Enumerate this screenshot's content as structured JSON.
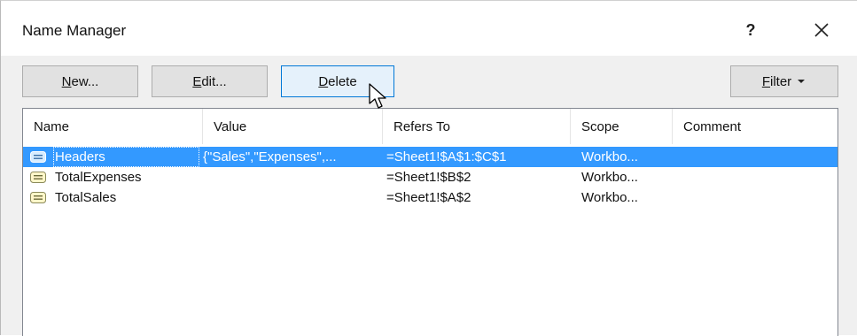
{
  "window": {
    "title": "Name Manager",
    "help_label": "?"
  },
  "toolbar": {
    "new_label": "New...",
    "edit_label": "Edit...",
    "delete_label": "Delete",
    "filter_label": "Filter"
  },
  "table": {
    "columns": [
      "Name",
      "Value",
      "Refers To",
      "Scope",
      "Comment"
    ],
    "rows": [
      {
        "name": "Headers",
        "value": "{\"Sales\",\"Expenses\",...",
        "refers_to": "=Sheet1!$A$1:$C$1",
        "scope": "Workbo...",
        "comment": "",
        "selected": true
      },
      {
        "name": "TotalExpenses",
        "value": "",
        "refers_to": "=Sheet1!$B$2",
        "scope": "Workbo...",
        "comment": "",
        "selected": false
      },
      {
        "name": "TotalSales",
        "value": "",
        "refers_to": "=Sheet1!$A$2",
        "scope": "Workbo...",
        "comment": "",
        "selected": false
      }
    ]
  },
  "icons": {
    "name_icon": "defined-name-icon",
    "close": "close-icon",
    "dropdown": "caret-down-icon",
    "cursor": "mouse-pointer-icon"
  },
  "colors": {
    "selection": "#3399ff",
    "focus_border": "#0078d7",
    "button_face": "#e1e1e1"
  }
}
